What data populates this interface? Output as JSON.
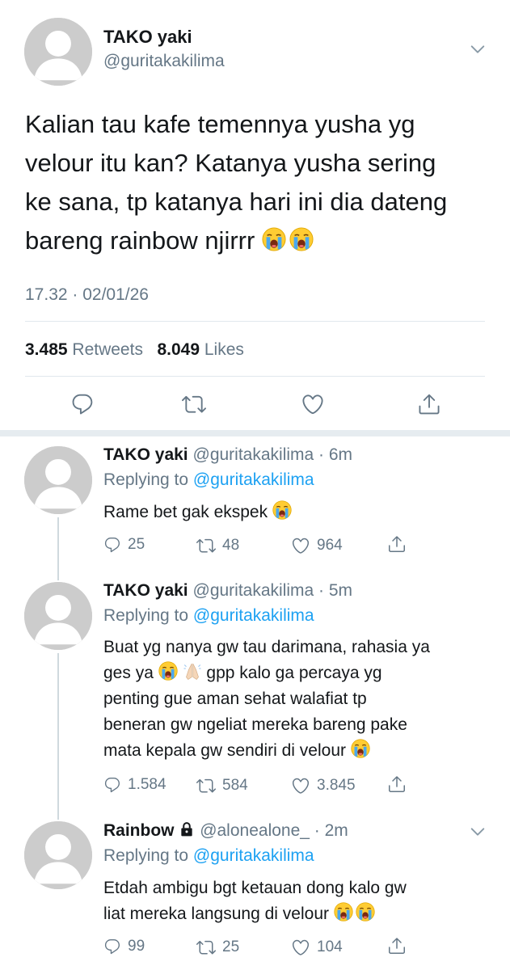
{
  "colors": {
    "accent": "#1da1f2",
    "muted": "#657786",
    "text": "#14171a",
    "divider": "#e1e8ed"
  },
  "main_tweet": {
    "display_name": "TAKO yaki",
    "handle": "@guritakakilima",
    "text_lines": [
      "Kalian tau kafe temennya yusha yg",
      "velour itu kan? Katanya yusha sering",
      "ke sana, tp katanya hari ini dia dateng",
      "bareng rainbow njirrr"
    ],
    "emojis": [
      "loudly-crying-face-icon",
      "loudly-crying-face-icon"
    ],
    "timestamp": "17.32 · 02/01/26",
    "retweets_count": "3.485",
    "retweets_label": "Retweets",
    "likes_count": "8.049",
    "likes_label": "Likes"
  },
  "replies": [
    {
      "display_name": "TAKO yaki",
      "meta": "@guritakakilima · 6m",
      "replying_prefix": "Replying to",
      "replying_handle": "@guritakakilima",
      "text_lines": [
        "Rame bet gak ekspek"
      ],
      "reply_count": "25",
      "retweet_count": "48",
      "like_count": "964"
    },
    {
      "display_name": "TAKO yaki",
      "meta": "@guritakakilima · 5m",
      "replying_prefix": "Replying to",
      "replying_handle": "@guritakakilima",
      "text_lines": [
        "Buat yg nanya gw tau darimana, rahasia ya",
        "ges ya",
        "gpp kalo ga percaya yg",
        "penting gue aman sehat walafiat tp",
        "beneran gw ngeliat mereka bareng pake",
        "mata kepala gw sendiri di velour"
      ],
      "reply_count": "1.584",
      "retweet_count": "584",
      "like_count": "3.845"
    },
    {
      "display_name": "Rainbow",
      "meta": "@alonealone_ · 2m",
      "replying_prefix": "Replying to",
      "replying_handle": "@guritakakilima",
      "text_lines": [
        "Etdah ambigu bgt ketauan dong kalo gw",
        "liat mereka langsung di velour"
      ],
      "reply_count": "99",
      "retweet_count": "25",
      "like_count": "104"
    }
  ]
}
